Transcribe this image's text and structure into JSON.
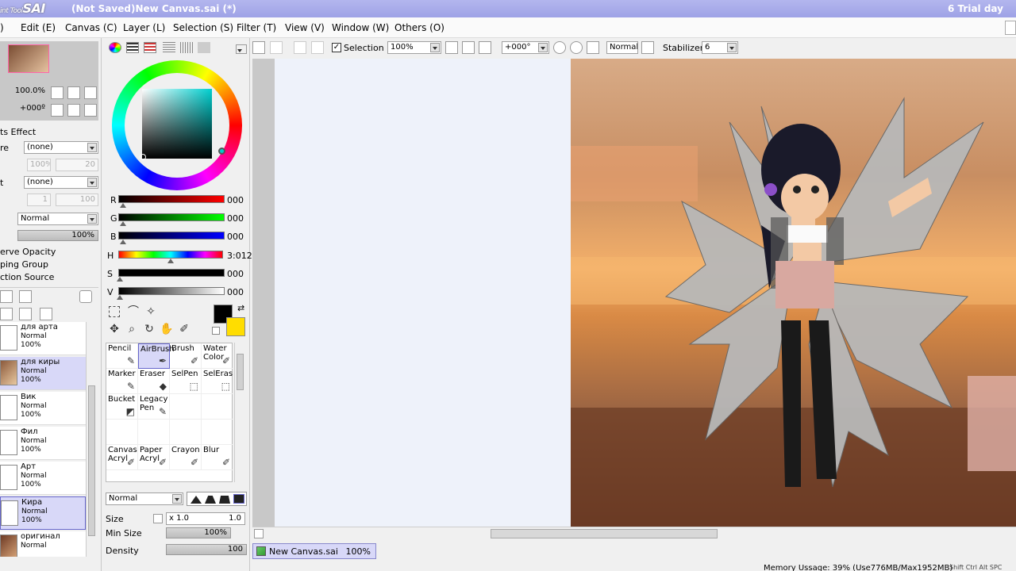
{
  "titlebar": {
    "logo_prefix": "int Tool",
    "logo": "SAI",
    "title": "(Not Saved)New Canvas.sai (*)",
    "trial": "6 Trial day"
  },
  "menu": {
    "items": [
      "Edit (E)",
      "Canvas (C)",
      "Layer (L)",
      "Selection (S)",
      "Filter (T)",
      "View (V)",
      "Window (W)",
      "Others (O)"
    ],
    "cut_item": ")"
  },
  "navigator": {
    "zoom": "100.0%",
    "angle": "+000º"
  },
  "layer_props": {
    "effects_header": "ts Effect",
    "texture_label": "re",
    "texture_value": "(none)",
    "texture_pct": "100%",
    "texture_num": "20",
    "effect_label": "t",
    "effect_value": "(none)",
    "effect_num1": "1",
    "effect_num2": "100",
    "blend_mode": "Normal",
    "opacity": "100%",
    "opt1": "erve Opacity",
    "opt2": "ping Group",
    "opt3": "ction Source"
  },
  "layers": [
    {
      "name": "для арта",
      "mode": "Normal",
      "opacity": "100%"
    },
    {
      "name": "для киры",
      "mode": "Normal",
      "opacity": "100%"
    },
    {
      "name": "Вик",
      "mode": "Normal",
      "opacity": "100%"
    },
    {
      "name": "Фил",
      "mode": "Normal",
      "opacity": "100%"
    },
    {
      "name": "Арт",
      "mode": "Normal",
      "opacity": "100%"
    },
    {
      "name": "Кира",
      "mode": "Normal",
      "opacity": "100%"
    },
    {
      "name": "оригинал",
      "mode": "Normal",
      "opacity": ""
    }
  ],
  "color": {
    "primary": "#000000",
    "secondary": "#ffdd00",
    "r_label": "R",
    "r_value": "000",
    "g_label": "G",
    "g_value": "000",
    "b_label": "B",
    "b_value": "000",
    "h_label": "H",
    "h_value": "3:012",
    "s_label": "S",
    "s_value": "000",
    "v_label": "V",
    "v_value": "000"
  },
  "tools": [
    {
      "label1": "Pencil",
      "label2": ""
    },
    {
      "label1": "AirBrush",
      "label2": ""
    },
    {
      "label1": "Brush",
      "label2": ""
    },
    {
      "label1": "Water",
      "label2": "Color"
    },
    {
      "label1": "Marker",
      "label2": ""
    },
    {
      "label1": "Eraser",
      "label2": ""
    },
    {
      "label1": "SelPen",
      "label2": ""
    },
    {
      "label1": "SelEras",
      "label2": ""
    },
    {
      "label1": "Bucket",
      "label2": ""
    },
    {
      "label1": "Legacy",
      "label2": "Pen"
    },
    {
      "label1": "Canvas",
      "label2": "Acryl"
    },
    {
      "label1": "Paper",
      "label2": "Acryl"
    },
    {
      "label1": "Crayon",
      "label2": ""
    },
    {
      "label1": "Blur",
      "label2": ""
    }
  ],
  "brush": {
    "mode": "Normal",
    "size_label": "Size",
    "size_mult": "x 1.0",
    "size_value": "1.0",
    "minsize_label": "Min Size",
    "minsize_value": "100%",
    "density_label": "Density",
    "density_value": "100"
  },
  "toolbar": {
    "selection_label": "Selection",
    "zoom": "100%",
    "rotation": "+000°",
    "blend": "Normal",
    "stabilizer_label": "Stabilizer",
    "stabilizer_value": "6"
  },
  "status": {
    "doc_tab": "New Canvas.sai",
    "doc_zoom": "100%",
    "memory": "Memory Ussage: 39% (Use776MB/Max1952MB)",
    "keys": "Shift Ctrl Alt SPC"
  }
}
